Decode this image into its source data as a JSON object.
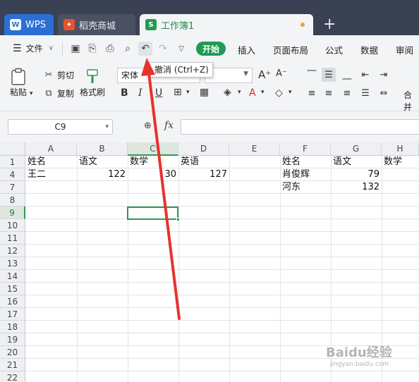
{
  "tabs": [
    {
      "label": "WPS",
      "icon": "wps-icon"
    },
    {
      "label": "稻壳商城",
      "icon": "daoke-icon"
    },
    {
      "label": "工作簿1",
      "icon": "spreadsheet-icon"
    }
  ],
  "menubar": {
    "file_label": "文件",
    "items": [
      "开始",
      "插入",
      "页面布局",
      "公式",
      "数据",
      "审阅"
    ]
  },
  "ribbon": {
    "paste": "粘贴",
    "cut": "剪切",
    "copy": "复制",
    "format_painter": "格式刷",
    "font_name": "宋体",
    "merge": "合并"
  },
  "tooltip": "撤消 (Ctrl+Z)",
  "formula_bar": {
    "name_box": "C9",
    "fx": "fx",
    "formula": ""
  },
  "grid": {
    "columns": [
      "A",
      "B",
      "C",
      "D",
      "E",
      "F",
      "G",
      "H"
    ],
    "active_column": "C",
    "rows": [
      "1",
      "4",
      "7",
      "8",
      "9",
      "10",
      "11",
      "12",
      "13",
      "14",
      "15",
      "16",
      "17",
      "18",
      "19",
      "20",
      "21",
      "22"
    ],
    "active_row": "9",
    "cells": {
      "A1": "姓名",
      "B1": "语文",
      "C1": "数学",
      "D1": "英语",
      "A4": "王二",
      "B4": "122",
      "C4": "30",
      "D4": "127",
      "F1": "姓名",
      "G1": "语文",
      "H1": "数学",
      "F4": "肖俊辉",
      "G4": "79",
      "F7": "河东",
      "G7": "132"
    }
  },
  "watermark": {
    "text": "Baidu经验",
    "sub": "jingyan.baidu.com"
  },
  "colors": {
    "accent": "#1f9b53",
    "arrow": "#e8322c",
    "tabbar": "#3a4152"
  }
}
